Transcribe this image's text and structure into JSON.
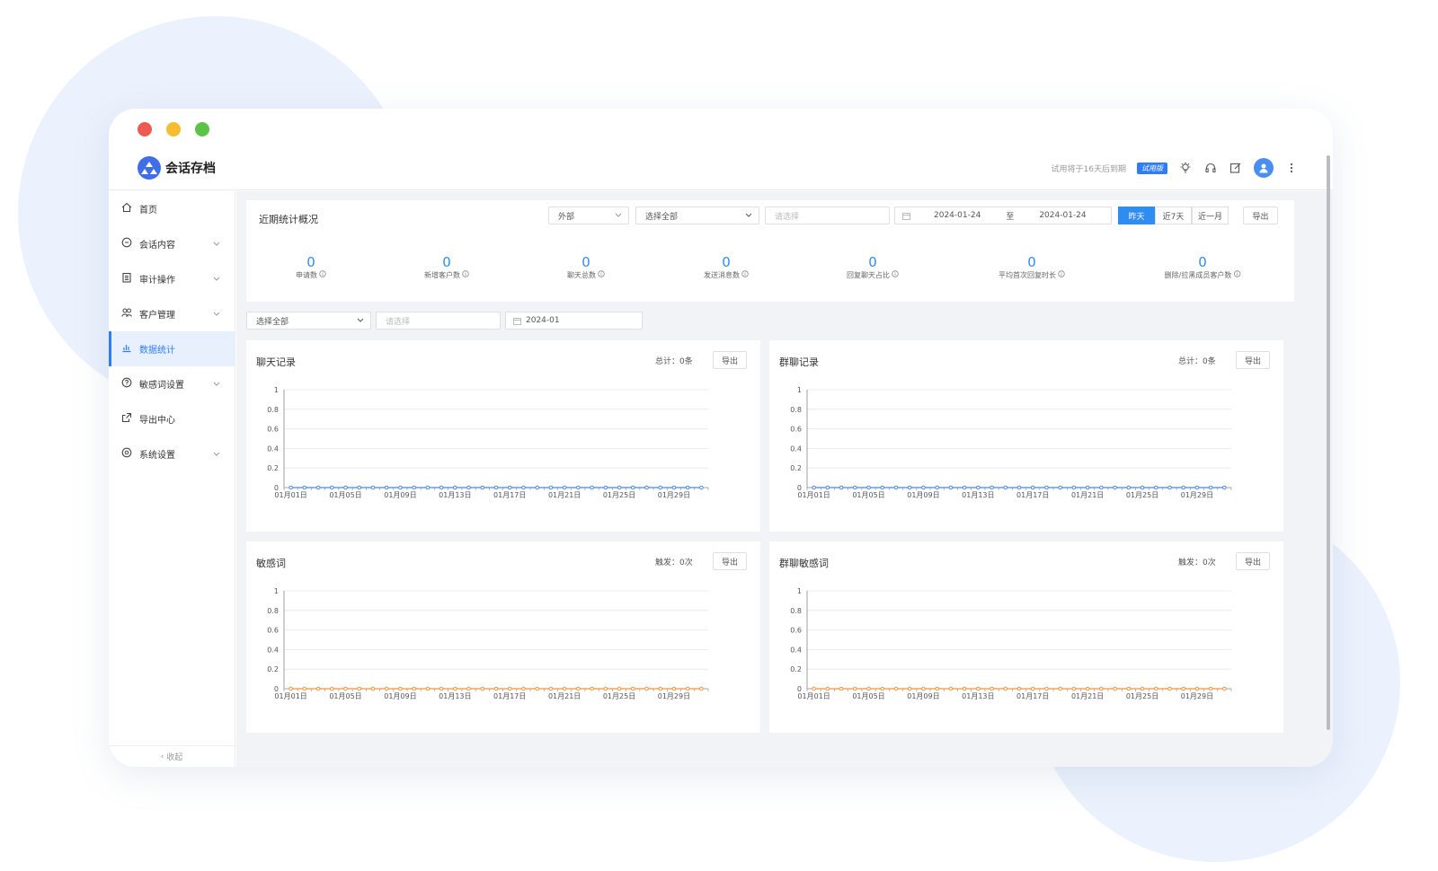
{
  "app": {
    "title": "会话存档"
  },
  "header": {
    "trial_notice": "试用将于16天后到期",
    "trial_badge": "试用版"
  },
  "sidebar": {
    "items": [
      {
        "label": "首页",
        "icon": "home-icon",
        "expandable": false
      },
      {
        "label": "会话内容",
        "icon": "chat-icon",
        "expandable": true
      },
      {
        "label": "审计操作",
        "icon": "clipboard-icon",
        "expandable": true
      },
      {
        "label": "客户管理",
        "icon": "users-icon",
        "expandable": true
      },
      {
        "label": "数据统计",
        "icon": "bar-chart-icon",
        "expandable": false,
        "active": true
      },
      {
        "label": "敏感词设置",
        "icon": "question-circle-icon",
        "expandable": true
      },
      {
        "label": "导出中心",
        "icon": "export-icon",
        "expandable": false
      },
      {
        "label": "系统设置",
        "icon": "gear-icon",
        "expandable": true
      }
    ],
    "collapse_label": "收起"
  },
  "overview": {
    "title": "近期统计概况",
    "type_select": "外部",
    "scope_select": "选择全部",
    "member_placeholder": "请选择",
    "date_start": "2024-01-24",
    "date_sep": "至",
    "date_end": "2024-01-24",
    "ranges": [
      "昨天",
      "近7天",
      "近一月"
    ],
    "active_range": "昨天",
    "export_label": "导出",
    "stats": [
      {
        "value": "0",
        "label": "申请数"
      },
      {
        "value": "0",
        "label": "新增客户数"
      },
      {
        "value": "0",
        "label": "聊天总数"
      },
      {
        "value": "0",
        "label": "发送消息数"
      },
      {
        "value": "0",
        "label": "回复聊天占比"
      },
      {
        "value": "0",
        "label": "平均首次回复时长"
      },
      {
        "value": "0",
        "label": "删除/拉黑成员客户数"
      }
    ]
  },
  "filters": {
    "scope_select": "选择全部",
    "member_placeholder": "请选择",
    "month": "2024-01"
  },
  "colors": {
    "accent": "#2f8cf0",
    "series_blue": "#4a88e8",
    "series_orange": "#f5923e"
  },
  "chart_data": [
    {
      "type": "line",
      "title": "聊天记录",
      "summary": "总计：0条",
      "export_label": "导出",
      "x": [
        "01月01日",
        "01月02日",
        "01月03日",
        "01月04日",
        "01月05日",
        "01月06日",
        "01月07日",
        "01月08日",
        "01月09日",
        "01月10日",
        "01月11日",
        "01月12日",
        "01月13日",
        "01月14日",
        "01月15日",
        "01月16日",
        "01月17日",
        "01月18日",
        "01月19日",
        "01月20日",
        "01月21日",
        "01月22日",
        "01月23日",
        "01月24日",
        "01月25日",
        "01月26日",
        "01月27日",
        "01月28日",
        "01月29日",
        "01月30日",
        "01月31日"
      ],
      "x_tick_labels": [
        "01月01日",
        "01月05日",
        "01月09日",
        "01月13日",
        "01月17日",
        "01月21日",
        "01月25日",
        "01月29日"
      ],
      "y_ticks": [
        "0",
        "0.2",
        "0.4",
        "0.6",
        "0.8",
        "1"
      ],
      "ylim": [
        0,
        1
      ],
      "series": [
        {
          "values": [
            0,
            0,
            0,
            0,
            0,
            0,
            0,
            0,
            0,
            0,
            0,
            0,
            0,
            0,
            0,
            0,
            0,
            0,
            0,
            0,
            0,
            0,
            0,
            0,
            0,
            0,
            0,
            0,
            0,
            0,
            0
          ],
          "color": "#4a88e8"
        }
      ]
    },
    {
      "type": "line",
      "title": "群聊记录",
      "summary": "总计：0条",
      "export_label": "导出",
      "x": [
        "01月01日",
        "01月02日",
        "01月03日",
        "01月04日",
        "01月05日",
        "01月06日",
        "01月07日",
        "01月08日",
        "01月09日",
        "01月10日",
        "01月11日",
        "01月12日",
        "01月13日",
        "01月14日",
        "01月15日",
        "01月16日",
        "01月17日",
        "01月18日",
        "01月19日",
        "01月20日",
        "01月21日",
        "01月22日",
        "01月23日",
        "01月24日",
        "01月25日",
        "01月26日",
        "01月27日",
        "01月28日",
        "01月29日",
        "01月30日",
        "01月31日"
      ],
      "x_tick_labels": [
        "01月01日",
        "01月05日",
        "01月09日",
        "01月13日",
        "01月17日",
        "01月21日",
        "01月25日",
        "01月29日"
      ],
      "y_ticks": [
        "0",
        "0.2",
        "0.4",
        "0.6",
        "0.8",
        "1"
      ],
      "ylim": [
        0,
        1
      ],
      "series": [
        {
          "values": [
            0,
            0,
            0,
            0,
            0,
            0,
            0,
            0,
            0,
            0,
            0,
            0,
            0,
            0,
            0,
            0,
            0,
            0,
            0,
            0,
            0,
            0,
            0,
            0,
            0,
            0,
            0,
            0,
            0,
            0,
            0
          ],
          "color": "#4a88e8"
        }
      ]
    },
    {
      "type": "line",
      "title": "敏感词",
      "summary": "触发：0次",
      "export_label": "导出",
      "x": [
        "01月01日",
        "01月02日",
        "01月03日",
        "01月04日",
        "01月05日",
        "01月06日",
        "01月07日",
        "01月08日",
        "01月09日",
        "01月10日",
        "01月11日",
        "01月12日",
        "01月13日",
        "01月14日",
        "01月15日",
        "01月16日",
        "01月17日",
        "01月18日",
        "01月19日",
        "01月20日",
        "01月21日",
        "01月22日",
        "01月23日",
        "01月24日",
        "01月25日",
        "01月26日",
        "01月27日",
        "01月28日",
        "01月29日",
        "01月30日",
        "01月31日"
      ],
      "x_tick_labels": [
        "01月01日",
        "01月05日",
        "01月09日",
        "01月13日",
        "01月17日",
        "01月21日",
        "01月25日",
        "01月29日"
      ],
      "y_ticks": [
        "0",
        "0.2",
        "0.4",
        "0.6",
        "0.8",
        "1"
      ],
      "ylim": [
        0,
        1
      ],
      "series": [
        {
          "values": [
            0,
            0,
            0,
            0,
            0,
            0,
            0,
            0,
            0,
            0,
            0,
            0,
            0,
            0,
            0,
            0,
            0,
            0,
            0,
            0,
            0,
            0,
            0,
            0,
            0,
            0,
            0,
            0,
            0,
            0,
            0
          ],
          "color": "#f5923e"
        }
      ]
    },
    {
      "type": "line",
      "title": "群聊敏感词",
      "summary": "触发：0次",
      "export_label": "导出",
      "x": [
        "01月01日",
        "01月02日",
        "01月03日",
        "01月04日",
        "01月05日",
        "01月06日",
        "01月07日",
        "01月08日",
        "01月09日",
        "01月10日",
        "01月11日",
        "01月12日",
        "01月13日",
        "01月14日",
        "01月15日",
        "01月16日",
        "01月17日",
        "01月18日",
        "01月19日",
        "01月20日",
        "01月21日",
        "01月22日",
        "01月23日",
        "01月24日",
        "01月25日",
        "01月26日",
        "01月27日",
        "01月28日",
        "01月29日",
        "01月30日",
        "01月31日"
      ],
      "x_tick_labels": [
        "01月01日",
        "01月05日",
        "01月09日",
        "01月13日",
        "01月17日",
        "01月21日",
        "01月25日",
        "01月29日"
      ],
      "y_ticks": [
        "0",
        "0.2",
        "0.4",
        "0.6",
        "0.8",
        "1"
      ],
      "ylim": [
        0,
        1
      ],
      "series": [
        {
          "values": [
            0,
            0,
            0,
            0,
            0,
            0,
            0,
            0,
            0,
            0,
            0,
            0,
            0,
            0,
            0,
            0,
            0,
            0,
            0,
            0,
            0,
            0,
            0,
            0,
            0,
            0,
            0,
            0,
            0,
            0,
            0
          ],
          "color": "#f5923e"
        }
      ]
    }
  ]
}
